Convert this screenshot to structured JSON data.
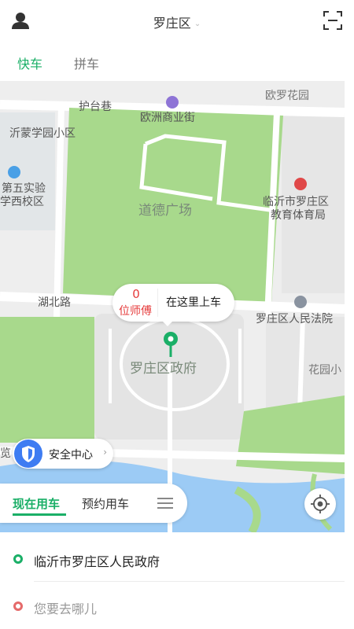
{
  "header": {
    "title": "罗庄区",
    "user_icon": "user-icon",
    "scan_icon": "scan-icon"
  },
  "tabs": [
    {
      "label": "快车",
      "active": true
    },
    {
      "label": "拼车",
      "active": false
    }
  ],
  "map": {
    "labels": {
      "hutaixiang": "护台巷",
      "ouluohuayuan": "欧罗花园",
      "ouzhou": "欧洲商业街",
      "yimeng": "沂蒙学园小区",
      "diwu_a": "第五实验",
      "diwu_b": "学西校区",
      "daode": "道德广场",
      "linyi_a": "临沂市罗庄区",
      "linyi_b": "教育体育局",
      "hubei": "湖北路",
      "fayuan": "罗庄区人民法院",
      "zhengfu": "罗庄区政府",
      "huayuan": "花园小",
      "lan": "览"
    }
  },
  "pickup": {
    "count": "0",
    "count_label": "位师傅",
    "here_label": "在这里上车"
  },
  "safety": {
    "label": "安全中心",
    "icon": "shield-icon"
  },
  "mode": {
    "now": "现在用车",
    "book": "预约用车",
    "menu_icon": "menu-icon"
  },
  "locate_icon": "locate-icon",
  "address": {
    "from": "临沂市罗庄区人民政府",
    "to_placeholder": "您要去哪儿"
  },
  "colors": {
    "accent": "#1aaf67",
    "park": "#a8d98c",
    "water": "#9ccbf5",
    "destination": "#e56a6a",
    "shield": "#3e7cf2"
  }
}
